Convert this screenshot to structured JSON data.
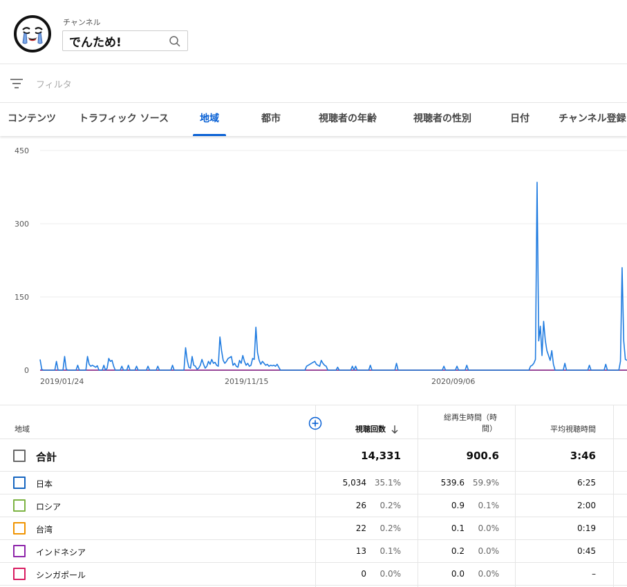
{
  "header": {
    "channel_label": "チャンネル",
    "channel_name": "でんため!"
  },
  "filter": {
    "placeholder": "フィルタ"
  },
  "tabs": [
    {
      "label": "コンテンツ",
      "active": false
    },
    {
      "label": "トラフィック ソース",
      "active": false
    },
    {
      "label": "地域",
      "active": true
    },
    {
      "label": "都市",
      "active": false
    },
    {
      "label": "視聴者の年齢",
      "active": false
    },
    {
      "label": "視聴者の性別",
      "active": false
    },
    {
      "label": "日付",
      "active": false
    },
    {
      "label": "チャンネル登録",
      "active": false
    }
  ],
  "chart_data": {
    "type": "line",
    "y_ticks": [
      "450",
      "300",
      "150",
      "0"
    ],
    "ylim": [
      0,
      450
    ],
    "x_tick_labels": [
      "2019/01/24",
      "2019/11/15",
      "2020/09/06"
    ],
    "grid": true,
    "series": [
      {
        "color": "#1f7be0",
        "values": [
          22,
          2,
          0,
          0,
          0,
          0,
          0,
          0,
          0,
          0,
          18,
          0,
          0,
          0,
          0,
          28,
          2,
          0,
          0,
          0,
          0,
          0,
          0,
          10,
          0,
          0,
          0,
          0,
          0,
          28,
          12,
          8,
          10,
          8,
          6,
          9,
          0,
          0,
          0,
          10,
          0,
          4,
          24,
          18,
          20,
          8,
          0,
          0,
          0,
          0,
          8,
          0,
          0,
          0,
          10,
          0,
          0,
          0,
          0,
          8,
          0,
          0,
          0,
          0,
          0,
          0,
          8,
          0,
          0,
          0,
          0,
          0,
          8,
          0,
          0,
          0,
          0,
          0,
          0,
          0,
          0,
          10,
          0,
          0,
          0,
          0,
          0,
          0,
          0,
          46,
          20,
          6,
          4,
          28,
          10,
          8,
          2,
          4,
          10,
          22,
          12,
          4,
          8,
          18,
          12,
          22,
          14,
          16,
          10,
          8,
          68,
          40,
          20,
          14,
          18,
          24,
          26,
          28,
          10,
          14,
          8,
          6,
          20,
          14,
          30,
          18,
          10,
          14,
          8,
          10,
          24,
          22,
          88,
          36,
          20,
          12,
          18,
          14,
          10,
          12,
          8,
          10,
          9,
          10,
          8,
          12,
          6,
          0,
          0,
          0,
          0,
          0,
          0,
          0,
          0,
          0,
          0,
          0,
          0,
          0,
          0,
          0,
          0,
          8,
          10,
          12,
          14,
          16,
          18,
          12,
          10,
          8,
          20,
          14,
          10,
          8,
          0,
          0,
          0,
          0,
          0,
          0,
          6,
          0,
          0,
          0,
          0,
          0,
          0,
          0,
          0,
          8,
          0,
          8,
          0,
          0,
          0,
          0,
          0,
          0,
          0,
          0,
          10,
          0,
          0,
          0,
          0,
          0,
          0,
          0,
          0,
          0,
          0,
          0,
          0,
          0,
          0,
          0,
          14,
          0,
          0,
          0,
          0,
          0,
          0,
          0,
          0,
          0,
          0,
          0,
          0,
          0,
          0,
          0,
          0,
          0,
          0,
          0,
          0,
          0,
          0,
          0,
          0,
          0,
          0,
          0,
          0,
          8,
          0,
          0,
          0,
          0,
          0,
          0,
          0,
          8,
          0,
          0,
          0,
          0,
          0,
          10,
          0,
          0,
          0,
          0,
          0,
          0,
          0,
          0,
          0,
          0,
          0,
          0,
          0,
          0,
          0,
          0,
          0,
          0,
          0,
          0,
          0,
          0,
          0,
          0,
          0,
          0,
          0,
          0,
          0,
          0,
          0,
          0,
          0,
          0,
          0,
          0,
          0,
          0,
          8,
          10,
          14,
          22,
          385,
          60,
          90,
          30,
          100,
          62,
          40,
          30,
          20,
          40,
          12,
          0,
          0,
          0,
          0,
          0,
          0,
          14,
          0,
          0,
          0,
          0,
          0,
          0,
          0,
          0,
          0,
          0,
          0,
          0,
          0,
          0,
          10,
          0,
          0,
          0,
          0,
          0,
          0,
          0,
          0,
          0,
          12,
          0,
          0,
          0,
          0,
          0,
          0,
          0,
          0,
          18,
          210,
          60,
          22,
          20
        ]
      },
      {
        "color": "#e8710a",
        "values": []
      },
      {
        "color": "#7cb342",
        "values": []
      },
      {
        "color": "#8e24aa",
        "values": []
      }
    ]
  },
  "table": {
    "headers": {
      "region": "地域",
      "views": "視聴回数",
      "watch_time_line1": "総再生時間（時",
      "watch_time_line2": "間）",
      "avg_duration": "平均視聴時間"
    },
    "total": {
      "name": "合計",
      "views": "14,331",
      "watch_time": "900.6",
      "avg": "3:46"
    },
    "rows": [
      {
        "name": "日本",
        "color": "#1565c0",
        "views": "5,034",
        "views_pct": "35.1%",
        "wt": "539.6",
        "wt_pct": "59.9%",
        "avg": "6:25"
      },
      {
        "name": "ロシア",
        "color": "#7cb342",
        "views": "26",
        "views_pct": "0.2%",
        "wt": "0.9",
        "wt_pct": "0.1%",
        "avg": "2:00"
      },
      {
        "name": "台湾",
        "color": "#f09300",
        "views": "22",
        "views_pct": "0.2%",
        "wt": "0.1",
        "wt_pct": "0.0%",
        "avg": "0:19"
      },
      {
        "name": "インドネシア",
        "color": "#8e24aa",
        "views": "13",
        "views_pct": "0.1%",
        "wt": "0.2",
        "wt_pct": "0.0%",
        "avg": "0:45"
      },
      {
        "name": "シンガポール",
        "color": "#d81b60",
        "views": "0",
        "views_pct": "0.0%",
        "wt": "0.0",
        "wt_pct": "0.0%",
        "avg": "–"
      }
    ]
  }
}
